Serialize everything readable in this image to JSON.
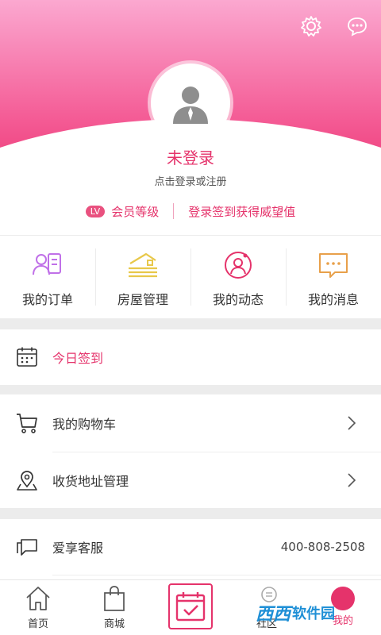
{
  "header": {
    "settings_icon": "gear-icon",
    "message_icon": "chat-bubble-icon",
    "avatar_icon": "user-silhouette-icon",
    "login_title": "未登录",
    "login_subtitle": "点击登录或注册"
  },
  "member": {
    "badge": "LV",
    "level_label": "会员等级",
    "signin_prompt": "登录签到获得威望值"
  },
  "grid": [
    {
      "label": "我的订单",
      "icon": "order-person-icon",
      "color": "#c070e8"
    },
    {
      "label": "房屋管理",
      "icon": "house-icon",
      "color": "#e8c84a"
    },
    {
      "label": "我的动态",
      "icon": "activity-face-icon",
      "color": "#e5336b"
    },
    {
      "label": "我的消息",
      "icon": "message-bubble-icon",
      "color": "#e8a04a"
    }
  ],
  "checkin": {
    "label": "今日签到",
    "icon": "calendar-icon"
  },
  "list": [
    {
      "label": "我的购物车",
      "icon": "shopping-cart-icon"
    },
    {
      "label": "收货地址管理",
      "icon": "location-pin-icon"
    }
  ],
  "service": {
    "label": "爱享客服",
    "icon": "chat-icon",
    "phone": "400-808-2508"
  },
  "tabbar": [
    {
      "label": "首页",
      "icon": "home-icon"
    },
    {
      "label": "商城",
      "icon": "shopping-bag-icon"
    },
    {
      "label": "",
      "icon": "calendar-check-icon"
    },
    {
      "label": "社区",
      "icon": "community-icon"
    },
    {
      "label": "我的",
      "icon": "me-icon"
    }
  ],
  "watermark": {
    "logo": "西西",
    "text": "软件园"
  },
  "colors": {
    "accent": "#e5336b",
    "hero_top": "#fba8d0",
    "hero_bottom": "#ee3f7b"
  }
}
